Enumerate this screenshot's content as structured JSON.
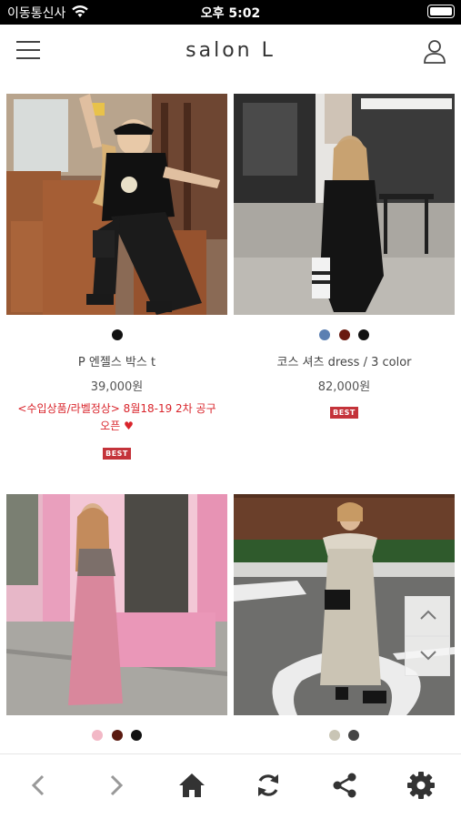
{
  "status_bar": {
    "carrier": "이동통신사",
    "time": "오후 5:02"
  },
  "header": {
    "brand": "salon L"
  },
  "products": [
    {
      "name": "P 엔젤스 박스 t",
      "price": "39,000원",
      "promo": "<수입상품/라벨정상> 8월18-19 2차 공구오픈 ♥",
      "badge": "BEST",
      "swatches": [
        "#111111"
      ]
    },
    {
      "name": "코스 셔츠 dress / 3 color",
      "price": "82,000원",
      "badge": "BEST",
      "swatches": [
        "#5b7fb2",
        "#6a1a10",
        "#111111"
      ]
    },
    {
      "swatches": [
        "#f2b8c6",
        "#5a1a10",
        "#111111"
      ]
    },
    {
      "swatches": [
        "#c9c5b5",
        "#444444"
      ]
    }
  ],
  "icons": {
    "menu": "menu-icon",
    "user": "user-icon",
    "back": "chevron-left-icon",
    "forward": "chevron-right-icon",
    "home": "home-icon",
    "refresh": "refresh-icon",
    "share": "share-icon",
    "settings": "gear-icon",
    "scroll_up": "chevron-up-icon",
    "scroll_down": "chevron-down-icon"
  },
  "colors": {
    "accent_red": "#d9242b",
    "badge": "#c4333a",
    "toolbar_icon": "#333333"
  }
}
